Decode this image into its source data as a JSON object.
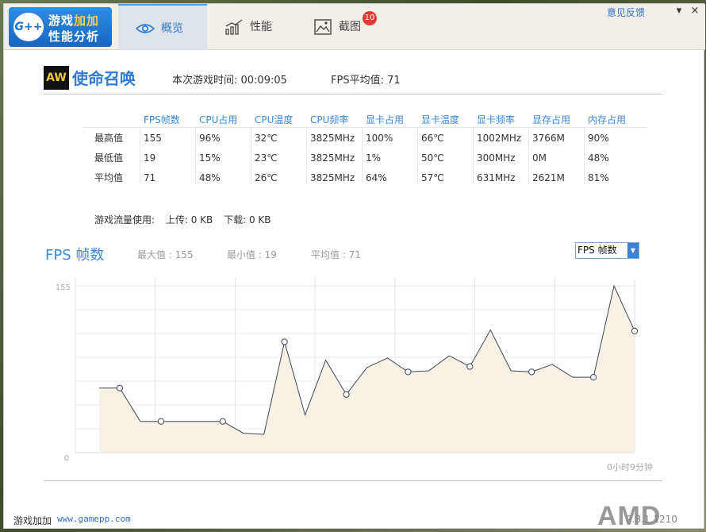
{
  "app": {
    "logo_mark": "G++",
    "logo_line1_a": "游戏",
    "logo_line1_b": "加加",
    "logo_line2": "性能分析",
    "feedback": "意见反馈",
    "minimize": "▾",
    "close": "×"
  },
  "tabs": [
    {
      "label": "概览",
      "icon": "eye-icon",
      "active": true
    },
    {
      "label": "性能",
      "icon": "bar-chart-icon",
      "active": false
    },
    {
      "label": "截图",
      "icon": "picture-icon",
      "active": false,
      "badge": "10"
    }
  ],
  "game": {
    "icon_text": "AW",
    "name": "使命召唤",
    "play_time": "本次游戏时间: 00:09:05",
    "fps_avg": "FPS平均值: 71"
  },
  "stats": {
    "columns": [
      "FPS帧数",
      "CPU占用",
      "CPU温度",
      "CPU频率",
      "显卡占用",
      "显卡温度",
      "显卡频率",
      "显存占用",
      "内存占用"
    ],
    "rows": [
      {
        "label": "最高值",
        "values": [
          "155",
          "96%",
          "32℃",
          "3825MHz",
          "100%",
          "66℃",
          "1002MHz",
          "3766M",
          "90%"
        ]
      },
      {
        "label": "最低值",
        "values": [
          "19",
          "15%",
          "23℃",
          "3825MHz",
          "1%",
          "50℃",
          "300MHz",
          "0M",
          "48%"
        ]
      },
      {
        "label": "平均值",
        "values": [
          "71",
          "48%",
          "26℃",
          "3825MHz",
          "64%",
          "57℃",
          "631MHz",
          "2621M",
          "81%"
        ]
      }
    ]
  },
  "traffic": {
    "label": "游戏流量使用:",
    "upload": "上传: 0 KB",
    "download": "下载: 0 KB"
  },
  "fps_panel": {
    "title": "FPS 帧数",
    "max": "最大值 : 155",
    "min": "最小值 : 19",
    "avg": "平均值 : 71",
    "select_value": "FPS 帧数"
  },
  "chart_data": {
    "type": "area",
    "ylim": [
      0,
      155
    ],
    "y_ticks": [
      "155",
      "0"
    ],
    "x_end_label": "0小时9分钟",
    "values": [
      60,
      60,
      29,
      29,
      29,
      29,
      29,
      18,
      17,
      103,
      35,
      86,
      54,
      79,
      88,
      75,
      76,
      90,
      80,
      114,
      76,
      75,
      82,
      70,
      70,
      155,
      113
    ],
    "markers": [
      1,
      3,
      6,
      9,
      12,
      15,
      18,
      21,
      24,
      26
    ],
    "fill_color": "#f7f1e6",
    "line_color": "#3a4656"
  },
  "footer": {
    "name": "游戏加加",
    "url": "www.gamepp.com",
    "version": "2.8.1.1210",
    "brand": "AMD"
  }
}
